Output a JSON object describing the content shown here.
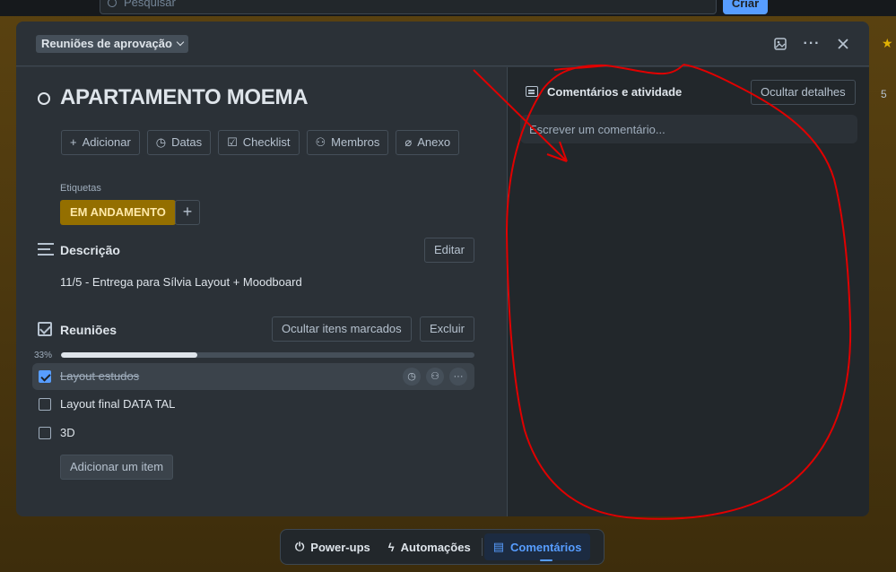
{
  "background": {
    "search_placeholder": "Pesquisar",
    "create_label": "Criar",
    "board_count": "5"
  },
  "modal": {
    "list_name": "Reuniões de aprovação",
    "title": "APARTAMENTO MOEMA",
    "actions": [
      {
        "label": "Adicionar",
        "icon": "plus-icon"
      },
      {
        "label": "Datas",
        "icon": "clock-icon"
      },
      {
        "label": "Checklist",
        "icon": "checkbox-icon"
      },
      {
        "label": "Membros",
        "icon": "member-icon"
      },
      {
        "label": "Anexo",
        "icon": "paperclip-icon"
      }
    ],
    "labels": {
      "title": "Etiquetas",
      "items": [
        {
          "text": "EM ANDAMENTO",
          "color": "#946f00"
        }
      ]
    },
    "description": {
      "title": "Descrição",
      "edit_label": "Editar",
      "text": "11/5 - Entrega para Sílvia Layout + Moodboard"
    },
    "checklist": {
      "title": "Reuniões",
      "hide_checked_label": "Ocultar itens marcados",
      "delete_label": "Excluir",
      "progress_label": "33%",
      "progress": 0.33,
      "items": [
        {
          "text": "Layout estudos",
          "checked": true
        },
        {
          "text": "Layout final DATA TAL",
          "checked": false
        },
        {
          "text": "3D",
          "checked": false
        }
      ],
      "add_item_label": "Adicionar um item"
    },
    "comments": {
      "title": "Comentários e atividade",
      "hide_details_label": "Ocultar detalhes",
      "input_placeholder": "Escrever um comentário..."
    }
  },
  "dock": {
    "powerups_label": "Power-ups",
    "automations_label": "Automações",
    "comments_label": "Comentários"
  },
  "colors": {
    "accent": "#579dff",
    "annotation": "#e00000"
  }
}
